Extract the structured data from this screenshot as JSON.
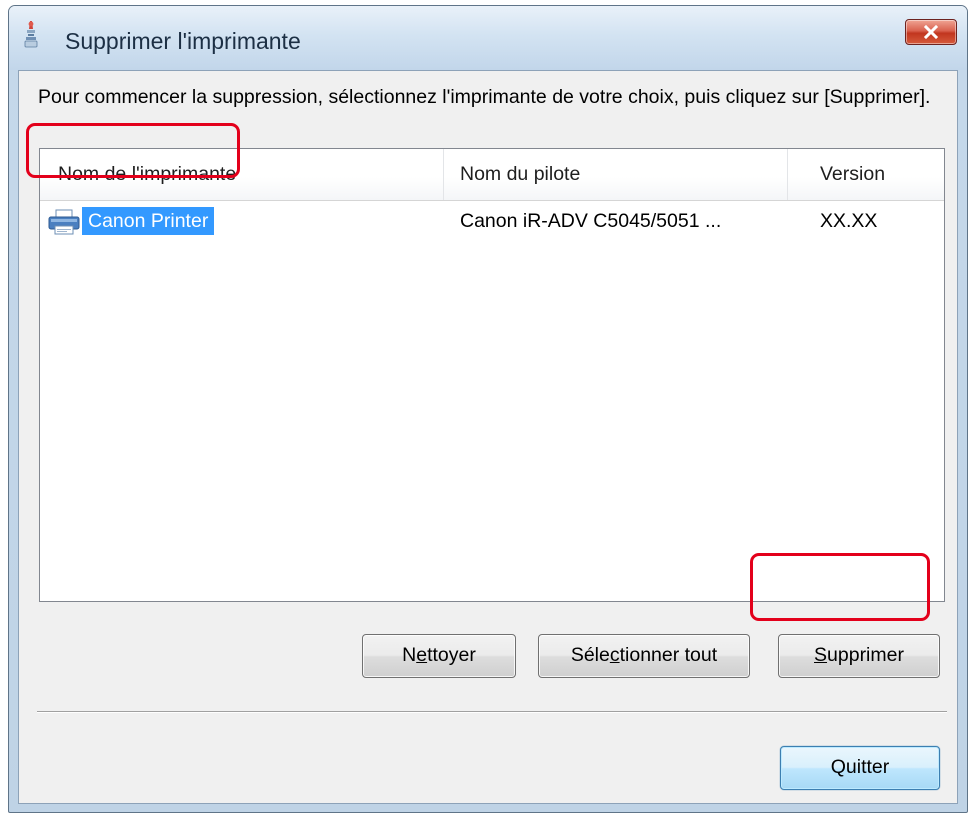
{
  "window": {
    "title": "Supprimer l'imprimante",
    "close_icon": "close-icon"
  },
  "instruction": "Pour commencer la suppression, sélectionnez l'imprimante de votre choix, puis cliquez sur [Supprimer].",
  "list": {
    "columns": [
      "Nom de l'imprimante",
      "Nom du pilote",
      "Version"
    ],
    "rows": [
      {
        "icon": "printer-icon",
        "name": "Canon Printer",
        "driver": "Canon iR-ADV C5045/5051 ...",
        "version": "XX.XX",
        "selected": true
      }
    ]
  },
  "buttons": {
    "nettoyer": {
      "label": "Nettoyer",
      "mnemonic_before": "N",
      "mnemonic": "e",
      "mnemonic_after": "ttoyer"
    },
    "select_all": {
      "label": "Sélectionner tout",
      "mnemonic_before": "Séle",
      "mnemonic": "c",
      "mnemonic_after": "tionner tout"
    },
    "supprimer": {
      "label": "Supprimer",
      "mnemonic_before": "",
      "mnemonic": "S",
      "mnemonic_after": "upprimer"
    },
    "quitter": {
      "label": "Quitter"
    }
  },
  "colors": {
    "selection": "#3399ff",
    "highlight_ring": "#e3001b",
    "close_button": "#c1361f"
  }
}
